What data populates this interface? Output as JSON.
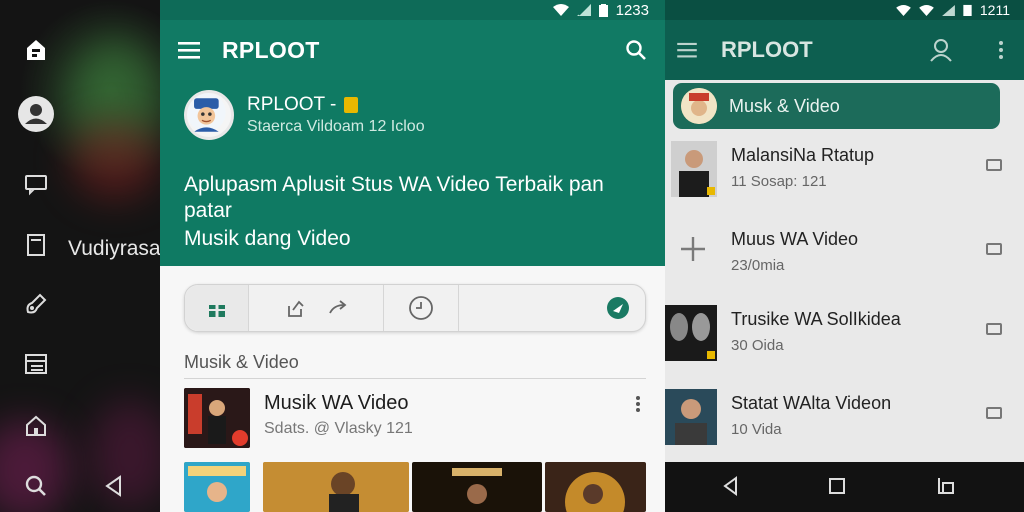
{
  "left": {
    "label": "Vudiyrasan",
    "nav_icons": [
      "logo-icon",
      "profile-icon",
      "chat-icon",
      "page-icon",
      "brush-icon",
      "list-icon",
      "home-icon",
      "search-icon"
    ]
  },
  "center": {
    "status_time": "1233",
    "app_title": "RPLOOT",
    "hero": {
      "name": "RPLOOT -",
      "subtitle": "Staerca Vildoam 12 Icloo",
      "description": "Aplupasm Aplusit Stus WA Video Terbaik pan patar",
      "description2": "Musik dang Video"
    },
    "section_title": "Musik & Video",
    "video": {
      "title": "Musik WA Video",
      "subtitle": "Sdats. @ Vlasky 121"
    }
  },
  "right": {
    "status_time": "1211",
    "app_title": "RPLOOT",
    "chip_label": "Musk & Video",
    "items": [
      {
        "title": "MalansiNa Rtatup",
        "subtitle": "11 Sosap: 121"
      },
      {
        "title": "Muus WA Video",
        "subtitle": "23/0mia"
      },
      {
        "title": "Trusike WA SolIkidea",
        "subtitle": "30 Oida"
      },
      {
        "title": "Statat WAlta Videon",
        "subtitle": "10 Vida"
      }
    ]
  },
  "colors": {
    "accent": "#117a64",
    "accent_dark": "#0e6b58",
    "right_appbar": "#0d5f50",
    "chip": "#1c6b5a"
  }
}
